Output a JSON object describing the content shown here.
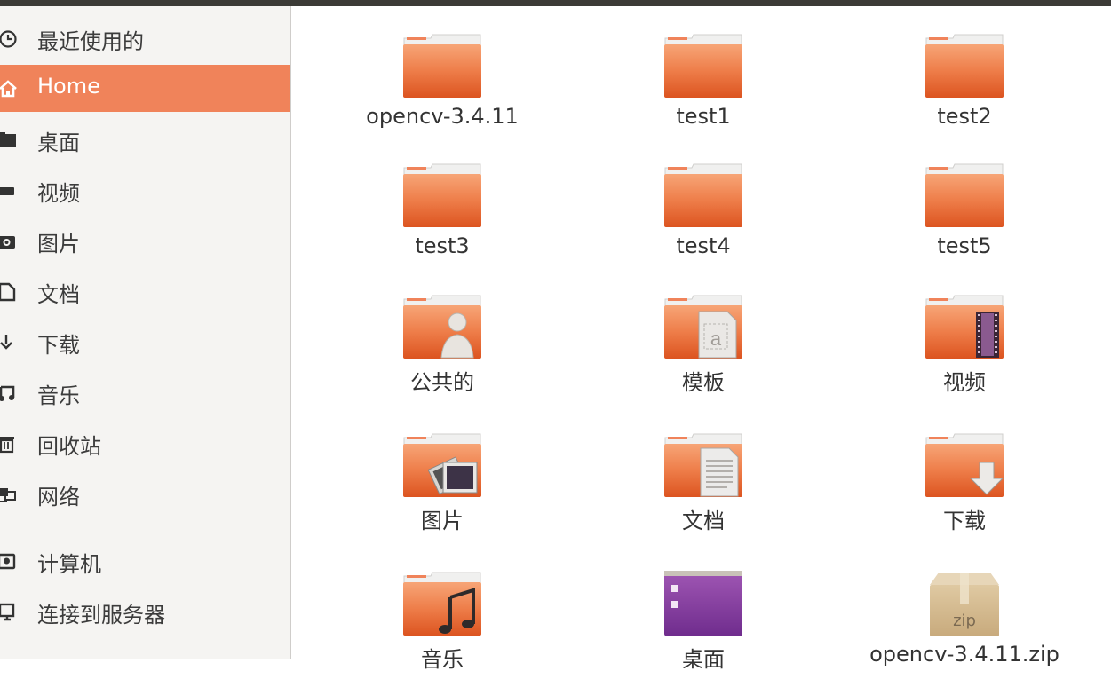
{
  "sidebar": {
    "items": [
      {
        "label": "最近使用的",
        "icon": "clock-icon"
      },
      {
        "label": "Home",
        "icon": "home-icon",
        "active": true
      },
      {
        "label": "桌面",
        "icon": "desktop-folder-icon"
      },
      {
        "label": "视频",
        "icon": "video-icon"
      },
      {
        "label": "图片",
        "icon": "camera-icon"
      },
      {
        "label": "文档",
        "icon": "document-icon"
      },
      {
        "label": "下载",
        "icon": "download-icon"
      },
      {
        "label": "音乐",
        "icon": "music-icon"
      },
      {
        "label": "回收站",
        "icon": "trash-icon"
      },
      {
        "label": "网络",
        "icon": "network-icon"
      },
      {
        "label": "计算机",
        "icon": "computer-icon"
      },
      {
        "label": "连接到服务器",
        "icon": "server-connect-icon"
      }
    ]
  },
  "files": [
    {
      "name": "opencv-3.4.11",
      "type": "folder"
    },
    {
      "name": "test1",
      "type": "folder"
    },
    {
      "name": "test2",
      "type": "folder"
    },
    {
      "name": "test3",
      "type": "folder"
    },
    {
      "name": "test4",
      "type": "folder"
    },
    {
      "name": "test5",
      "type": "folder"
    },
    {
      "name": "公共的",
      "type": "folder-public"
    },
    {
      "name": "模板",
      "type": "folder-templates"
    },
    {
      "name": "视频",
      "type": "folder-videos"
    },
    {
      "name": "图片",
      "type": "folder-pictures"
    },
    {
      "name": "文档",
      "type": "folder-documents"
    },
    {
      "name": "下载",
      "type": "folder-download"
    },
    {
      "name": "音乐",
      "type": "folder-music"
    },
    {
      "name": "桌面",
      "type": "folder-desktop"
    },
    {
      "name": "opencv-3.4.11.zip",
      "type": "zip-archive",
      "badge": "zip"
    }
  ],
  "colors": {
    "accent": "#f0835a",
    "folder_top": "#f7a577",
    "folder_bottom": "#e05a23"
  }
}
